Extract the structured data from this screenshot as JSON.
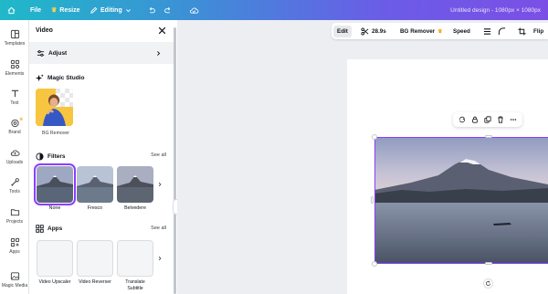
{
  "topbar": {
    "file_label": "File",
    "resize_label": "Resize",
    "editing_label": "Editing",
    "design_title": "Untitled design - 1080px × 1080px"
  },
  "rail": {
    "items": [
      {
        "label": "Templates",
        "icon": "templates-icon"
      },
      {
        "label": "Elements",
        "icon": "elements-icon"
      },
      {
        "label": "Text",
        "icon": "text-icon"
      },
      {
        "label": "Brand",
        "icon": "brand-icon"
      },
      {
        "label": "Uploads",
        "icon": "uploads-icon"
      },
      {
        "label": "Tools",
        "icon": "tools-icon"
      },
      {
        "label": "Projects",
        "icon": "projects-icon"
      },
      {
        "label": "Apps",
        "icon": "apps-icon"
      },
      {
        "label": "Magic Media",
        "icon": "magic-media-icon"
      }
    ]
  },
  "panel": {
    "title": "Video",
    "adjust_label": "Adjust",
    "magic_studio_label": "Magic Studio",
    "bg_remover_label": "BG Remover",
    "filters_label": "Filters",
    "filters_see_all": "See all",
    "filters": [
      {
        "label": "None",
        "selected": true
      },
      {
        "label": "Fresco",
        "selected": false
      },
      {
        "label": "Belvedere",
        "selected": false
      }
    ],
    "apps_label": "Apps",
    "apps_see_all": "See all",
    "apps": [
      {
        "label": "Video Upscaler"
      },
      {
        "label": "Video Reverser"
      },
      {
        "label": "Translate Subtitle"
      }
    ]
  },
  "context_bar": {
    "edit_label": "Edit",
    "duration": "28.9s",
    "bg_remover_label": "BG Remover",
    "speed_label": "Speed",
    "flip_label": "Flip"
  },
  "colors": {
    "accent": "#8b3dff",
    "crown": "#f5a623"
  }
}
